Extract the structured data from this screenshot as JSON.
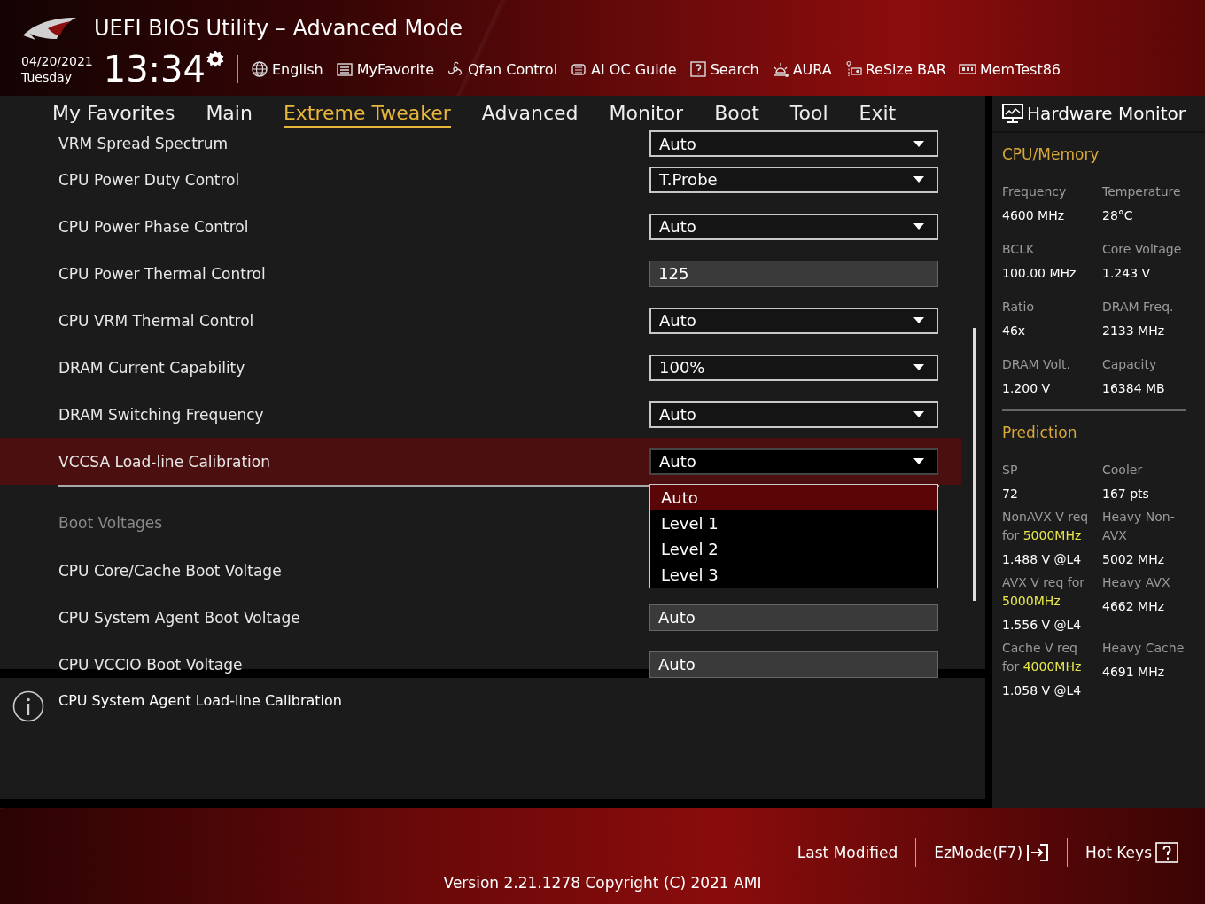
{
  "header": {
    "title": "UEFI BIOS Utility – Advanced Mode",
    "date": "04/20/2021",
    "day": "Tuesday",
    "time": "13:34",
    "tools": [
      {
        "kind": "globe",
        "label": "English"
      },
      {
        "kind": "list",
        "label": "MyFavorite"
      },
      {
        "kind": "fan",
        "label": "Qfan Control"
      },
      {
        "kind": "chip",
        "label": "AI OC Guide"
      },
      {
        "kind": "question",
        "label": "Search"
      },
      {
        "kind": "sun",
        "label": "AURA"
      },
      {
        "kind": "card",
        "label": "ReSize BAR"
      },
      {
        "kind": "memory",
        "label": "MemTest86"
      }
    ]
  },
  "tabs": [
    {
      "label": "My Favorites",
      "selected": false
    },
    {
      "label": "Main",
      "selected": false
    },
    {
      "label": "Extreme Tweaker",
      "selected": true
    },
    {
      "label": "Advanced",
      "selected": false
    },
    {
      "label": "Monitor",
      "selected": false
    },
    {
      "label": "Boot",
      "selected": false
    },
    {
      "label": "Tool",
      "selected": false
    },
    {
      "label": "Exit",
      "selected": false
    }
  ],
  "settings": [
    {
      "kind": "select",
      "label": "VRM Spread Spectrum",
      "value": "Auto",
      "selected": false
    },
    {
      "kind": "select",
      "label": "CPU Power Duty Control",
      "value": "T.Probe",
      "selected": false
    },
    {
      "kind": "select",
      "label": "CPU Power Phase Control",
      "value": "Auto",
      "selected": false
    },
    {
      "kind": "input",
      "label": "CPU Power Thermal Control",
      "value": "125",
      "selected": false
    },
    {
      "kind": "select",
      "label": "CPU VRM Thermal Control",
      "value": "Auto",
      "selected": false
    },
    {
      "kind": "select",
      "label": "DRAM Current Capability",
      "value": "100%",
      "selected": false
    },
    {
      "kind": "select",
      "label": "DRAM Switching Frequency",
      "value": "Auto",
      "selected": false
    },
    {
      "kind": "select",
      "label": "VCCSA Load-line Calibration",
      "value": "Auto",
      "selected": true,
      "options": [
        {
          "label": "Auto",
          "selected": true
        },
        {
          "label": "Level 1",
          "selected": false
        },
        {
          "label": "Level 2",
          "selected": false
        },
        {
          "label": "Level 3",
          "selected": false
        }
      ]
    },
    {
      "kind": "heading",
      "label": "Boot Voltages"
    },
    {
      "kind": "input",
      "label": "CPU Core/Cache Boot Voltage",
      "selected": false
    },
    {
      "kind": "input",
      "label": "CPU System Agent Boot Voltage",
      "value": "Auto",
      "selected": false
    },
    {
      "kind": "input",
      "label": "CPU VCCIO Boot Voltage",
      "value": "Auto",
      "selected": false
    }
  ],
  "help": {
    "text": "CPU System Agent Load-line Calibration"
  },
  "monitor": {
    "title": "Hardware Monitor",
    "sections": [
      {
        "title": "CPU/Memory",
        "items": [
          {
            "label": "Frequency",
            "value": "4600 MHz"
          },
          {
            "label": "Temperature",
            "value": "28°C"
          },
          {
            "label": "BCLK",
            "value": "100.00 MHz"
          },
          {
            "label": "Core Voltage",
            "value": "1.243 V"
          },
          {
            "label": "Ratio",
            "value": "46x"
          },
          {
            "label": "DRAM Freq.",
            "value": "2133 MHz"
          },
          {
            "label": "DRAM Volt.",
            "value": "1.200 V"
          },
          {
            "label": "Capacity",
            "value": "16384 MB"
          }
        ]
      },
      {
        "title": "Prediction",
        "items": [
          {
            "label": "SP",
            "value": "72"
          },
          {
            "label": "Cooler",
            "value": "167 pts"
          },
          {
            "label": "NonAVX V req for **5000MHz**",
            "value": "1.488 V @L4"
          },
          {
            "label": "Heavy Non-AVX",
            "value": "5002 MHz"
          },
          {
            "label": "AVX V req for **5000MHz**",
            "value": "1.556 V @L4"
          },
          {
            "label": "Heavy AVX",
            "value": "4662 MHz"
          },
          {
            "label": "Cache V req for **4000MHz**",
            "value": "1.058 V @L4"
          },
          {
            "label": "Heavy Cache",
            "value": "4691 MHz"
          }
        ]
      }
    ]
  },
  "footer": {
    "actions": [
      {
        "kind": "plain",
        "label": "Last Modified"
      },
      {
        "kind": "exit",
        "label": "EzMode(F7)"
      },
      {
        "kind": "help",
        "label": "Hot Keys"
      }
    ],
    "version": "Version 2.21.1278 Copyright (C) 2021 AMI"
  }
}
